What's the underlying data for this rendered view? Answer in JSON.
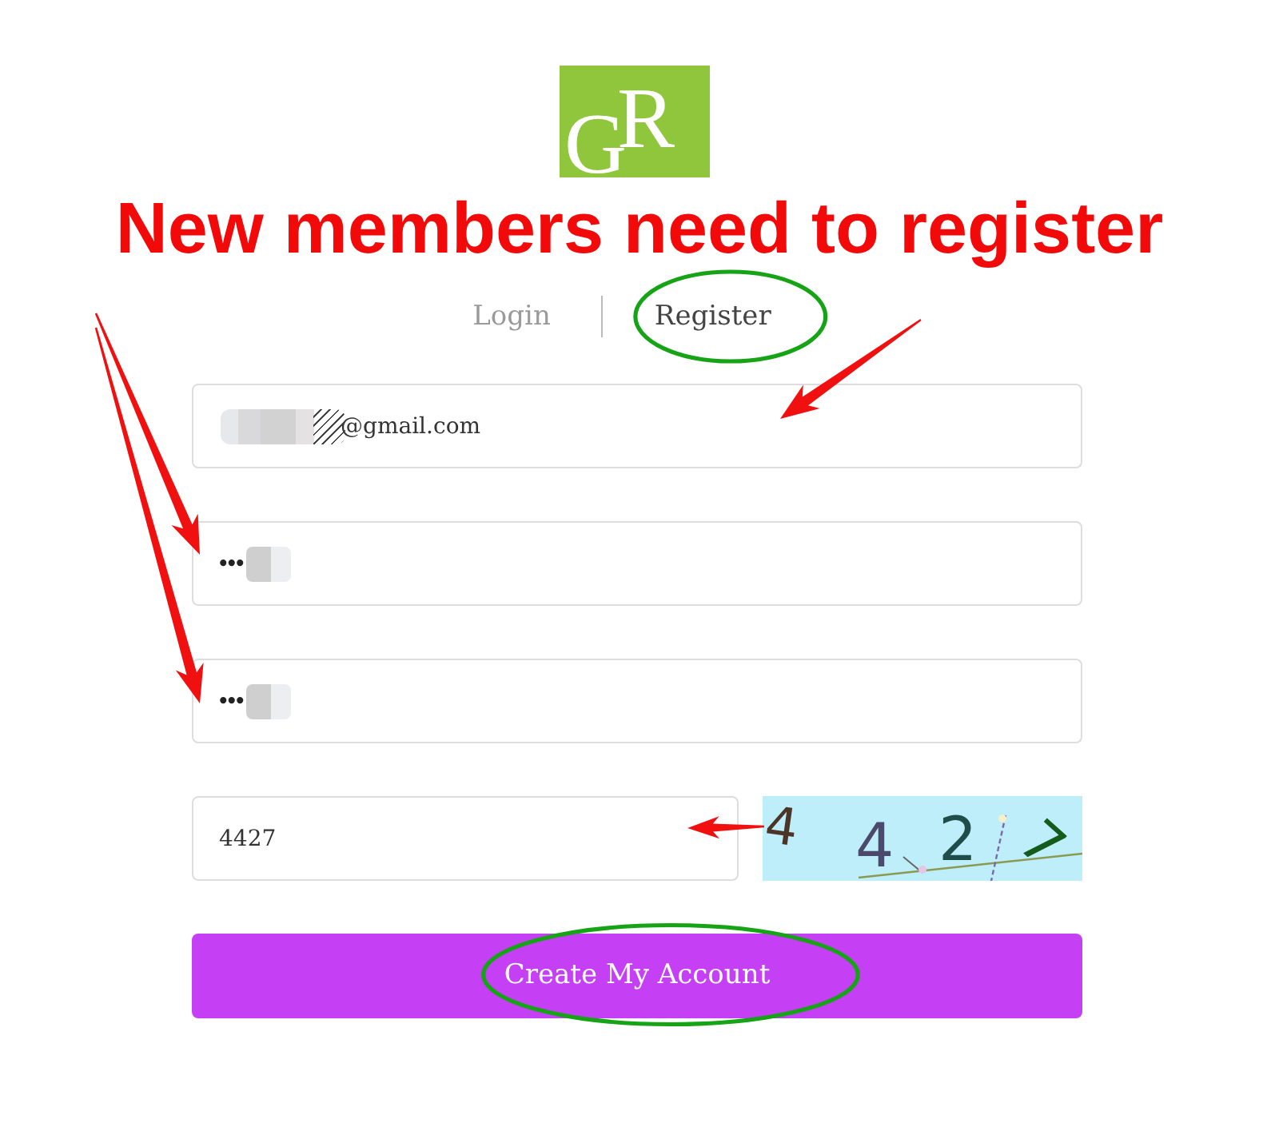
{
  "logo": {
    "letters": [
      "G",
      "R"
    ]
  },
  "headline": "New members need to register",
  "tabs": [
    {
      "label": "Login",
      "selected": false,
      "circled": false
    },
    {
      "label": "Register",
      "selected": true,
      "circled": true
    }
  ],
  "fields": [
    {
      "kind": "email",
      "value": "@gmail.com",
      "redacted": true,
      "arrow": true
    },
    {
      "kind": "password",
      "value": "•••",
      "redacted": true,
      "arrow": true
    },
    {
      "kind": "password",
      "value": "•••",
      "redacted": true,
      "arrow": true
    }
  ],
  "captcha": {
    "value": "4427",
    "arrow": true,
    "image_characters": [
      "4",
      "4",
      "2",
      "7"
    ]
  },
  "submit": {
    "label": "Create My Account",
    "circled": true
  }
}
